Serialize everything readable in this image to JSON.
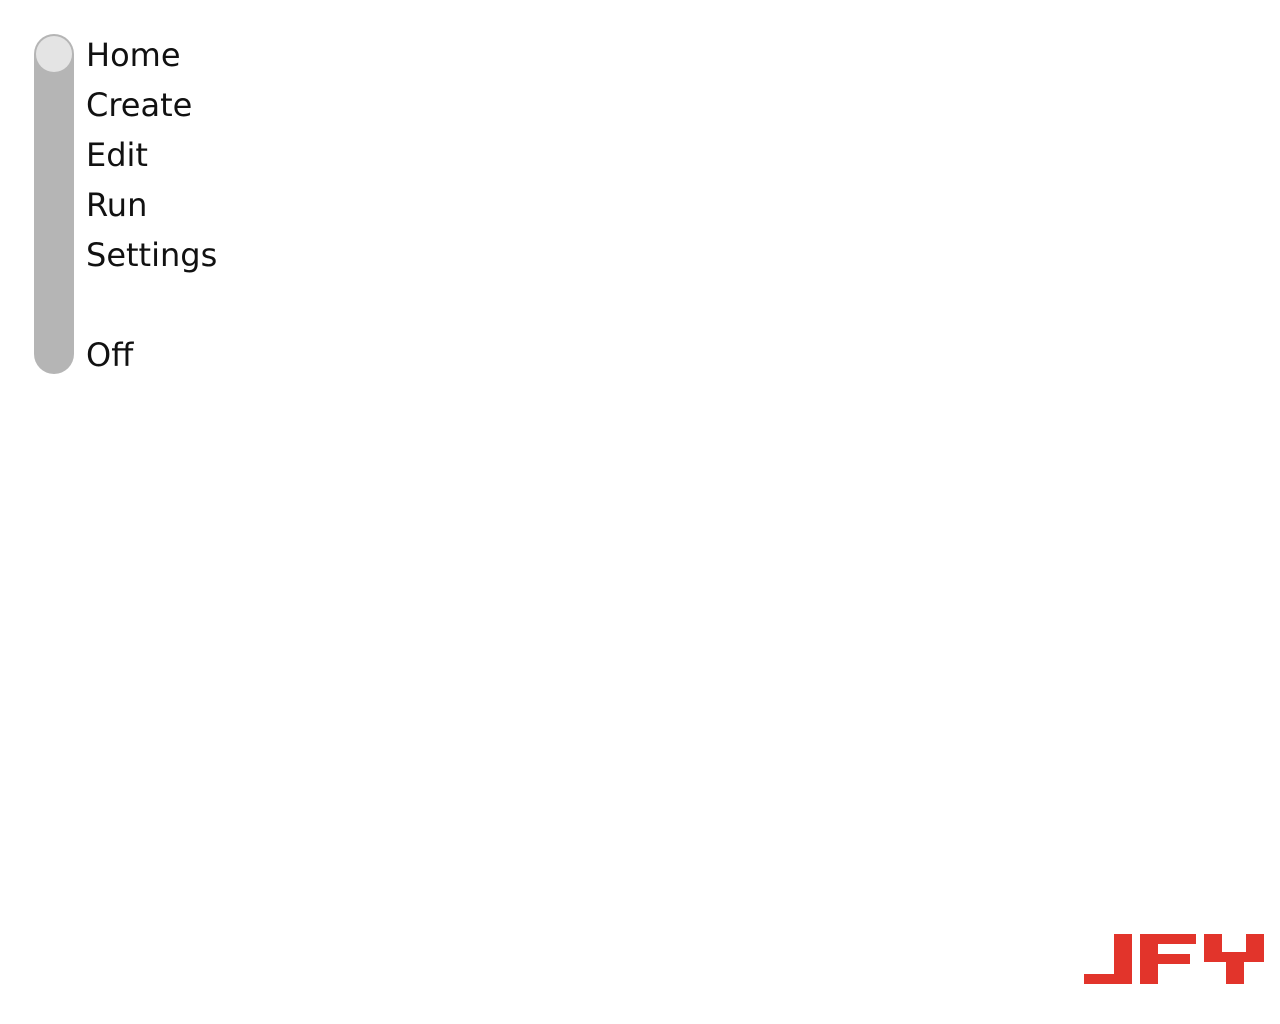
{
  "nav": {
    "items": [
      {
        "label": "Home"
      },
      {
        "label": "Create"
      },
      {
        "label": "Edit"
      },
      {
        "label": "Run"
      },
      {
        "label": "Settings"
      },
      {
        "label": "Off"
      }
    ],
    "selected_index": 0
  },
  "brand": {
    "logo_text": "JFY",
    "color": "#e2342b"
  },
  "colors": {
    "background": "#ffffff",
    "track": "#b5b5b5",
    "knob": "#e4e4e4",
    "text": "#111111"
  }
}
